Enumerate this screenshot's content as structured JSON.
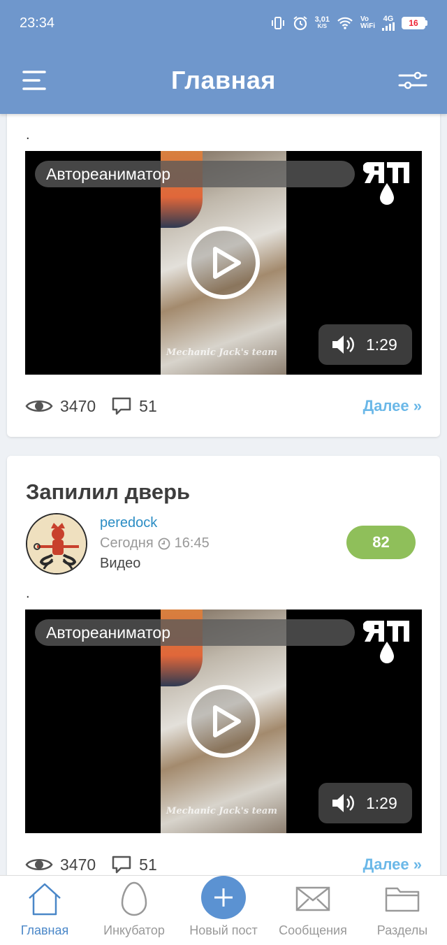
{
  "status_bar": {
    "time": "23:34",
    "net_speed": "3,01",
    "net_unit": "K/S",
    "vo": "Vo",
    "wifi_label": "WiFi",
    "signal": "4G",
    "battery": "16"
  },
  "header": {
    "title": "Главная"
  },
  "posts": [
    {
      "text": ".",
      "video": {
        "category": "Автореаниматор",
        "duration": "1:29",
        "watermark": "Mechanic Jack's team"
      },
      "stats": {
        "views": "3470",
        "comments": "51",
        "more": "Далее »"
      }
    },
    {
      "title": "Запилил дверь",
      "author": "peredock",
      "date": "Сегодня",
      "time": "16:45",
      "tag": "Видео",
      "rating": "82",
      "text": ".",
      "video": {
        "category": "Автореаниматор",
        "duration": "1:29",
        "watermark": "Mechanic Jack's team"
      },
      "stats": {
        "views": "3470",
        "comments": "51",
        "more": "Далее »"
      }
    }
  ],
  "bottom_nav": [
    {
      "label": "Главная",
      "icon": "home-icon",
      "active": true
    },
    {
      "label": "Инкубатор",
      "icon": "egg-icon",
      "active": false
    },
    {
      "label": "Новый пост",
      "icon": "plus-icon",
      "active": false
    },
    {
      "label": "Сообщения",
      "icon": "envelope-icon",
      "active": false
    },
    {
      "label": "Разделы",
      "icon": "folder-icon",
      "active": false
    }
  ],
  "colors": {
    "header_bg": "#6f97cc",
    "rating_bg": "#8fbf5a",
    "link": "#6bb8e8",
    "author": "#2b8dc4",
    "nav_active": "#4a87c8"
  }
}
